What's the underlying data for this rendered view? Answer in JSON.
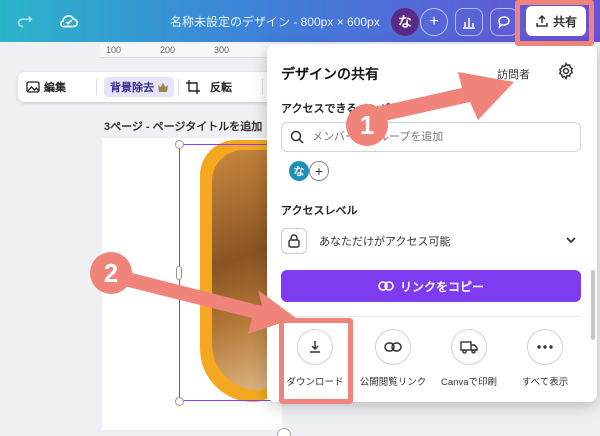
{
  "topbar": {
    "title": "名称未設定のデザイン - 800px × 600px",
    "avatar_initial": "な",
    "share_label": "共有"
  },
  "ruler": {
    "ticks": [
      "100",
      "200",
      "300"
    ]
  },
  "toolbar": {
    "edit_label": "編集",
    "bg_remove_label": "背景除去",
    "rotate_label": "反転"
  },
  "canvas": {
    "page_label": "3ページ - ページタイトルを追加"
  },
  "share_panel": {
    "title": "デザインの共有",
    "visitors_label": "訪問者",
    "members_label": "アクセスできるメンバー",
    "search_placeholder": "メンバー、グループを追加",
    "member_initial": "な",
    "access_level_label": "アクセスレベル",
    "access_value": "あなただけがアクセス可能",
    "copy_link_label": "リンクをコピー",
    "options": [
      {
        "label": "ダウンロード",
        "icon": "download-icon"
      },
      {
        "label": "公開閲覧リンク",
        "icon": "link-icon"
      },
      {
        "label": "Canvaで印刷",
        "icon": "truck-icon"
      },
      {
        "label": "すべて表示",
        "icon": "more-icon"
      }
    ]
  },
  "annotations": {
    "step1": "1",
    "step2": "2",
    "color": "#f0837a"
  }
}
